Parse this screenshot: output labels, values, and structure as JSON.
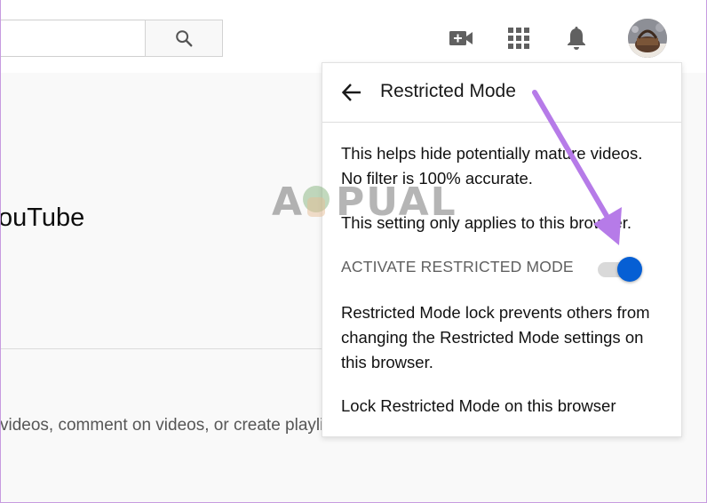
{
  "header": {
    "search_button_icon": "search-icon",
    "icons": [
      "video-camera-plus-icon",
      "apps-grid-icon",
      "bell-icon"
    ],
    "avatar": "user-avatar"
  },
  "background": {
    "title_fragment": "ouTube",
    "body_fragment": "videos, comment on videos, or create playli"
  },
  "panel": {
    "title": "Restricted Mode",
    "back_icon": "arrow-left-icon",
    "description_line1": "This helps hide potentially mature videos.",
    "description_line2": "No filter is 100% accurate.",
    "setting_note": "This setting only applies to this browser.",
    "activate_label": "ACTIVATE RESTRICTED MODE",
    "toggle_on": true,
    "lock_info_line1": "Restricted Mode lock prevents others from",
    "lock_info_line2": "changing the Restricted Mode settings on",
    "lock_info_line3": "this browser.",
    "lock_link": "Lock Restricted Mode on this browser"
  },
  "watermark": {
    "text": "APPUALS"
  },
  "colors": {
    "accent": "#065fd4",
    "annotation_arrow": "#b67be8",
    "frame": "#c79be0"
  }
}
